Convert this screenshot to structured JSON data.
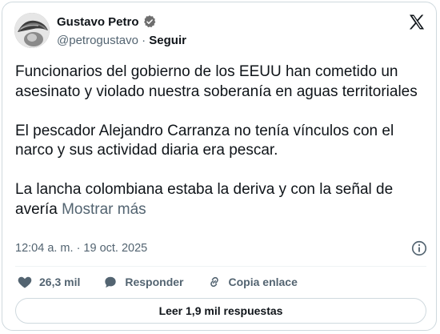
{
  "author": {
    "name": "Gustavo Petro",
    "handle": "@petrogustavo",
    "separator": "·",
    "follow_label": "Seguir"
  },
  "tweet": {
    "paragraphs": [
      "Funcionarios del gobierno de los EEUU han cometido un asesinato y violado nuestra soberanía en aguas territoriales",
      "El pescador Alejandro Carranza no tenía vínculos con el narco y sus actividad diaria era pescar.",
      "La lancha colombiana estaba la deriva y con la señal de avería"
    ],
    "show_more_label": "Mostrar más",
    "timestamp": "12:04 a. m. · 19 oct. 2025"
  },
  "actions": {
    "likes": "26,3 mil",
    "reply_label": "Responder",
    "copy_link_label": "Copia enlace"
  },
  "replies_button_label": "Leer 1,9 mil respuestas",
  "icons": {
    "verified": "verified-badge-icon",
    "brand": "x-logo-icon",
    "info": "info-icon",
    "like": "heart-icon",
    "reply": "speech-bubble-icon",
    "link": "link-icon"
  }
}
